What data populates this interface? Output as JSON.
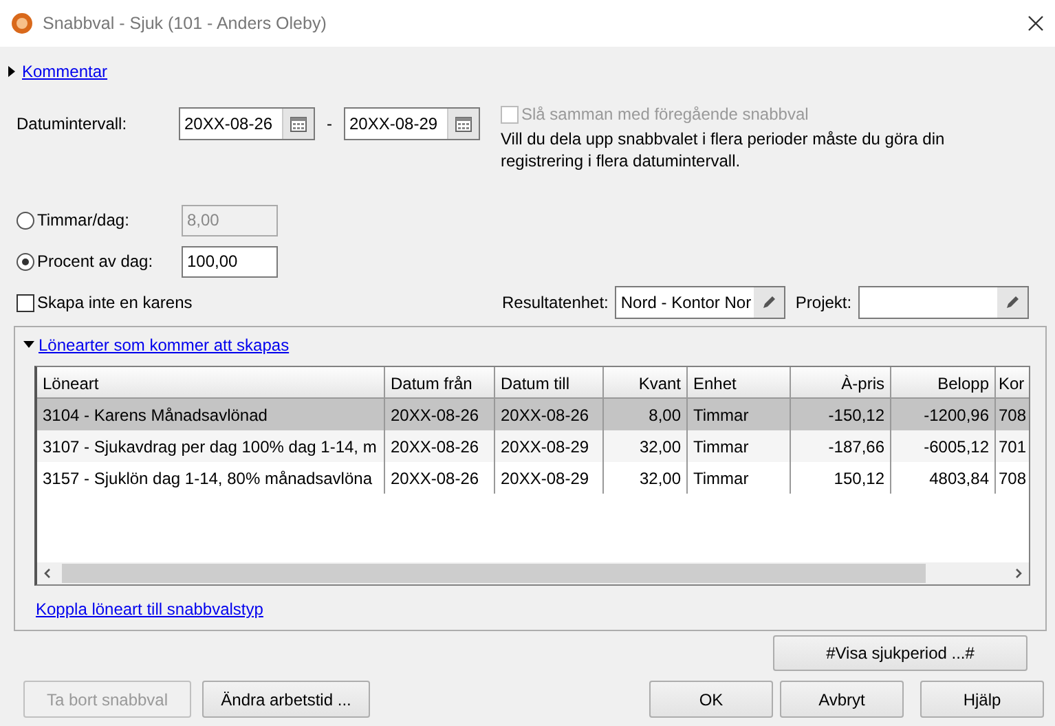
{
  "window": {
    "title": "Snabbval - Sjuk (101 - Anders Oleby)"
  },
  "comment_section": {
    "label": "Kommentar",
    "expanded": false
  },
  "date_range": {
    "label": "Datumintervall:",
    "from": "20XX-08-26",
    "separator": "-",
    "to": "20XX-08-29"
  },
  "merge_option": {
    "label": "Slå samman med föregående snabbval",
    "checked": false,
    "disabled": true
  },
  "note": "Vill du dela upp snabbvalet i flera perioder måste du göra din registrering i flera datumintervall.",
  "amount_options": [
    {
      "label": "Timmar/dag:",
      "value": "8,00",
      "selected": false
    },
    {
      "label": "Procent av dag:",
      "value": "100,00",
      "selected": true
    }
  ],
  "no_waiting_day": {
    "label": "Skapa inte en karens",
    "checked": false
  },
  "result_unit": {
    "label": "Resultatenhet:",
    "value": "Nord - Kontor Nor"
  },
  "project": {
    "label": "Projekt:"
  },
  "salary_types": {
    "label": "Lönearter som kommer att skapas",
    "expanded": true,
    "table": {
      "columns": [
        {
          "label": "Löneart",
          "kind": "text"
        },
        {
          "label": "Datum från",
          "kind": "text"
        },
        {
          "label": "Datum till",
          "kind": "text"
        },
        {
          "label": "Kvant",
          "kind": "number"
        },
        {
          "label": "Enhet",
          "kind": "text"
        },
        {
          "label": "À-pris",
          "kind": "number"
        },
        {
          "label": "Belopp",
          "kind": "number"
        },
        {
          "label": "Kor",
          "kind": "text"
        }
      ],
      "rows": [
        {
          "selected": true,
          "cells": [
            "3104 - Karens Månadsavlönad",
            "20XX-08-26",
            "20XX-08-26",
            "8,00",
            "Timmar",
            "-150,12",
            "-1200,96",
            "708"
          ]
        },
        {
          "selected": false,
          "cells": [
            "3107 - Sjukavdrag per dag 100% dag 1-14, m",
            "20XX-08-26",
            "20XX-08-29",
            "32,00",
            "Timmar",
            "-187,66",
            "-6005,12",
            "701"
          ]
        },
        {
          "selected": false,
          "cells": [
            "3157 - Sjuklön dag 1-14, 80% månadsavlöna",
            "20XX-08-26",
            "20XX-08-29",
            "32,00",
            "Timmar",
            "150,12",
            "4803,84",
            "708"
          ]
        }
      ]
    },
    "link": "Koppla löneart till snabbvalstyp"
  },
  "buttons": [
    {
      "label": "#Visa sjukperiod ...#",
      "kind": "side",
      "disabled": false
    },
    {
      "label": "Ta bort snabbval",
      "kind": "left",
      "disabled": true
    },
    {
      "label": "Ändra arbetstid ...",
      "kind": "left",
      "disabled": false
    },
    {
      "label": "OK",
      "kind": "right",
      "disabled": false
    },
    {
      "label": "Avbryt",
      "kind": "right",
      "disabled": false
    },
    {
      "label": "Hjälp",
      "kind": "right",
      "disabled": false
    }
  ]
}
